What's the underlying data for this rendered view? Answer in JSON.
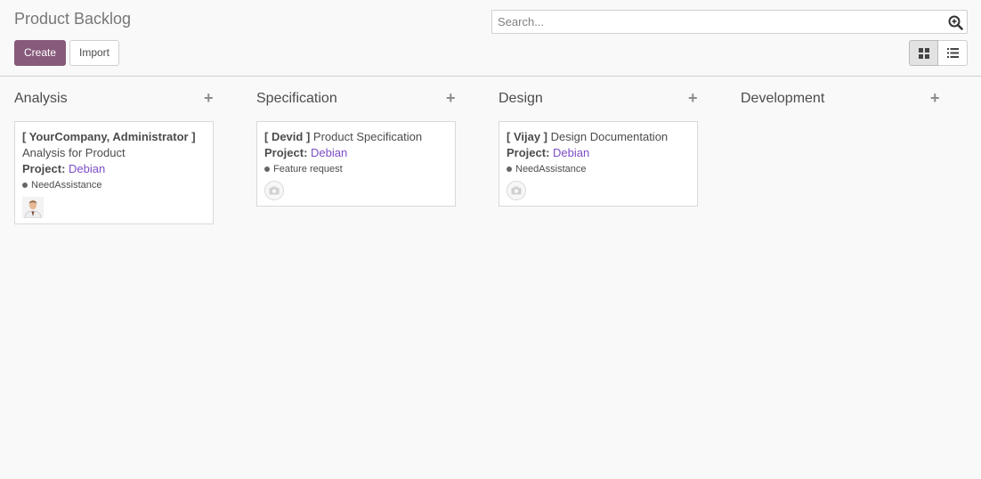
{
  "header": {
    "title": "Product Backlog",
    "create_label": "Create",
    "import_label": "Import"
  },
  "search": {
    "placeholder": "Search...",
    "value": ""
  },
  "view_switch": {
    "active": "kanban",
    "options": [
      "kanban-icon",
      "list-icon"
    ]
  },
  "colors": {
    "primary": "#875a7b",
    "link": "#7c4dc7",
    "background": "#f9f9f9"
  },
  "columns": [
    {
      "title": "Analysis",
      "cards": [
        {
          "assignee": "[ YourCompany, Administrator ]",
          "name": "Analysis for Product",
          "project_label": "Project:",
          "project": "Debian",
          "tag": "NeedAssistance",
          "avatar": "user-photo"
        }
      ]
    },
    {
      "title": "Specification",
      "cards": [
        {
          "assignee": "[ Devid ]",
          "name": "Product Specification",
          "project_label": "Project:",
          "project": "Debian",
          "tag": "Feature request",
          "avatar": "camera-placeholder-icon"
        }
      ]
    },
    {
      "title": "Design",
      "cards": [
        {
          "assignee": "[ Vijay ]",
          "name": "Design Documentation",
          "project_label": "Project:",
          "project": "Debian",
          "tag": "NeedAssistance",
          "avatar": "camera-placeholder-icon"
        }
      ]
    },
    {
      "title": "Development",
      "cards": []
    }
  ],
  "quick_add_symbol": "+"
}
